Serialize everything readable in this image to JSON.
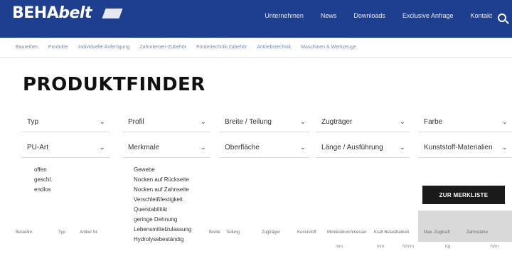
{
  "header": {
    "logo_main": "BEHA",
    "logo_belt": "belt",
    "nav": [
      "Unternehmen",
      "News",
      "Downloads",
      "Exclusive Anfrage",
      "Kontakt"
    ]
  },
  "categories": [
    "Baureihen",
    "Produkte",
    "Individuelle Anfertigung",
    "Zahnriemen-Zubehör",
    "Fördertechnik-Zubehör",
    "Antriebstechnik",
    "Maschinen & Werkzeuge"
  ],
  "page_title": "PRODUKTFINDER",
  "filters_row1": [
    "Typ",
    "Profil",
    "Breite / Teilung",
    "Zugträger",
    "Farbe"
  ],
  "filters_row2": [
    "PU-Art",
    "Merkmale",
    "Oberfläche",
    "Länge / Ausführung",
    "Kunststoff-Materialien"
  ],
  "options_col1": [
    "offen",
    "geschl.",
    "endlos"
  ],
  "options_col2": [
    "Gewebe",
    "Nocken auf Rückseite",
    "Nocken auf Zahnseite",
    "Verschleißfestigkeit",
    "Querstabilität",
    "geringe Dehnung",
    "Lebensmittelzulassung",
    "Hydrolysebeständig"
  ],
  "watch_button": "ZUR MERKLISTE",
  "table_headers": [
    "Bestellnr.",
    "Typ",
    "Artikel Nr.",
    "Breite",
    "Teilung",
    "Zugträger",
    "Kunststoff",
    "Mindestdurchmesser",
    "Kraft Belastbarkeit",
    "Max. Zugkraft",
    "Zahnstärke"
  ],
  "units": [
    "mm",
    "mm",
    "N/mm",
    "Kg",
    "N/m"
  ]
}
